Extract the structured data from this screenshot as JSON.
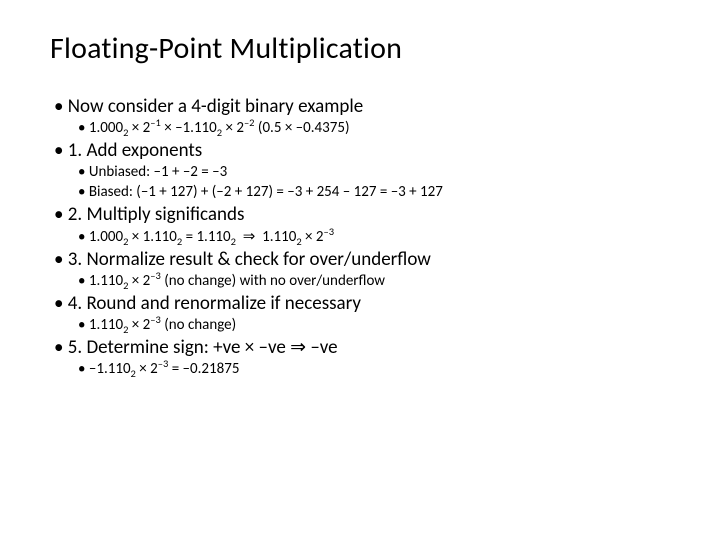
{
  "title": "Floating-Point Multiplication",
  "items": [
    {
      "lvl": 1,
      "html": "Now consider a 4-digit binary example"
    },
    {
      "lvl": 2,
      "html": "1.000<span class='sub'>2</span> × 2<span class='sup'>–1</span> × –1.110<span class='sub'>2</span> × 2<span class='sup'>–2</span> (0.5 × –0.4375)"
    },
    {
      "lvl": 1,
      "html": "1. Add exponents"
    },
    {
      "lvl": 2,
      "html": "Unbiased: –1 + –2 = –3"
    },
    {
      "lvl": 2,
      "html": "Biased: (–1 + 127) + (–2 + 127) = –3 + 254 – 127 = –3 + 127"
    },
    {
      "lvl": 1,
      "html": "2. Multiply significands"
    },
    {
      "lvl": 2,
      "html": "1.000<span class='sub'>2</span> × 1.110<span class='sub'>2</span> = 1.110<span class='sub'>2</span> &nbsp;⇒&nbsp; 1.110<span class='sub'>2</span> × 2<span class='sup'>–3</span>"
    },
    {
      "lvl": 1,
      "html": "3. Normalize result & check for over/underflow"
    },
    {
      "lvl": 2,
      "html": "1.110<span class='sub'>2</span> × 2<span class='sup'>–3</span> (no change) with no over/underflow"
    },
    {
      "lvl": 1,
      "html": "4. Round and renormalize if necessary"
    },
    {
      "lvl": 2,
      "html": "1.110<span class='sub'>2</span> × 2<span class='sup'>–3</span> (no change)"
    },
    {
      "lvl": 1,
      "html": "5. Determine sign: +ve × –ve ⇒ –ve"
    },
    {
      "lvl": 2,
      "html": "–1.110<span class='sub'>2</span> × 2<span class='sup'>–3</span>  = –0.21875"
    }
  ]
}
